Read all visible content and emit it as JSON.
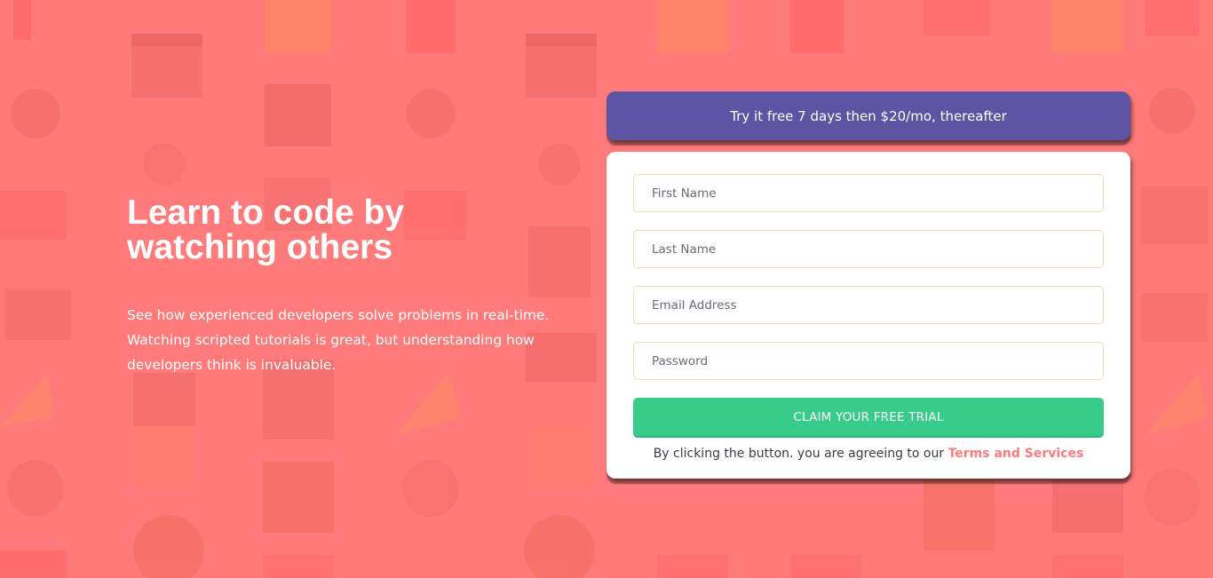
{
  "hero": {
    "title": "Learn to code by watching others",
    "description": "See how experienced developers solve problems in real-time. Watching scripted tutorials is great, but understanding how developers think is invaluable."
  },
  "promo": {
    "text": "Try it free 7 days then $20/mo, thereafter"
  },
  "form": {
    "first_name_placeholder": "First Name",
    "last_name_placeholder": "Last Name",
    "email_placeholder": "Email Address",
    "password_placeholder": "Password",
    "submit_label": "CLAIM YOUR FREE TRIAL",
    "terms_prefix": "By clicking the button. you are agreeing to our ",
    "terms_link": "Terms and Services"
  },
  "colors": {
    "background": "#ff7a7a",
    "promo": "#5e54a4",
    "accent_green": "#38cc8b",
    "field_border": "#f3dcb0"
  }
}
